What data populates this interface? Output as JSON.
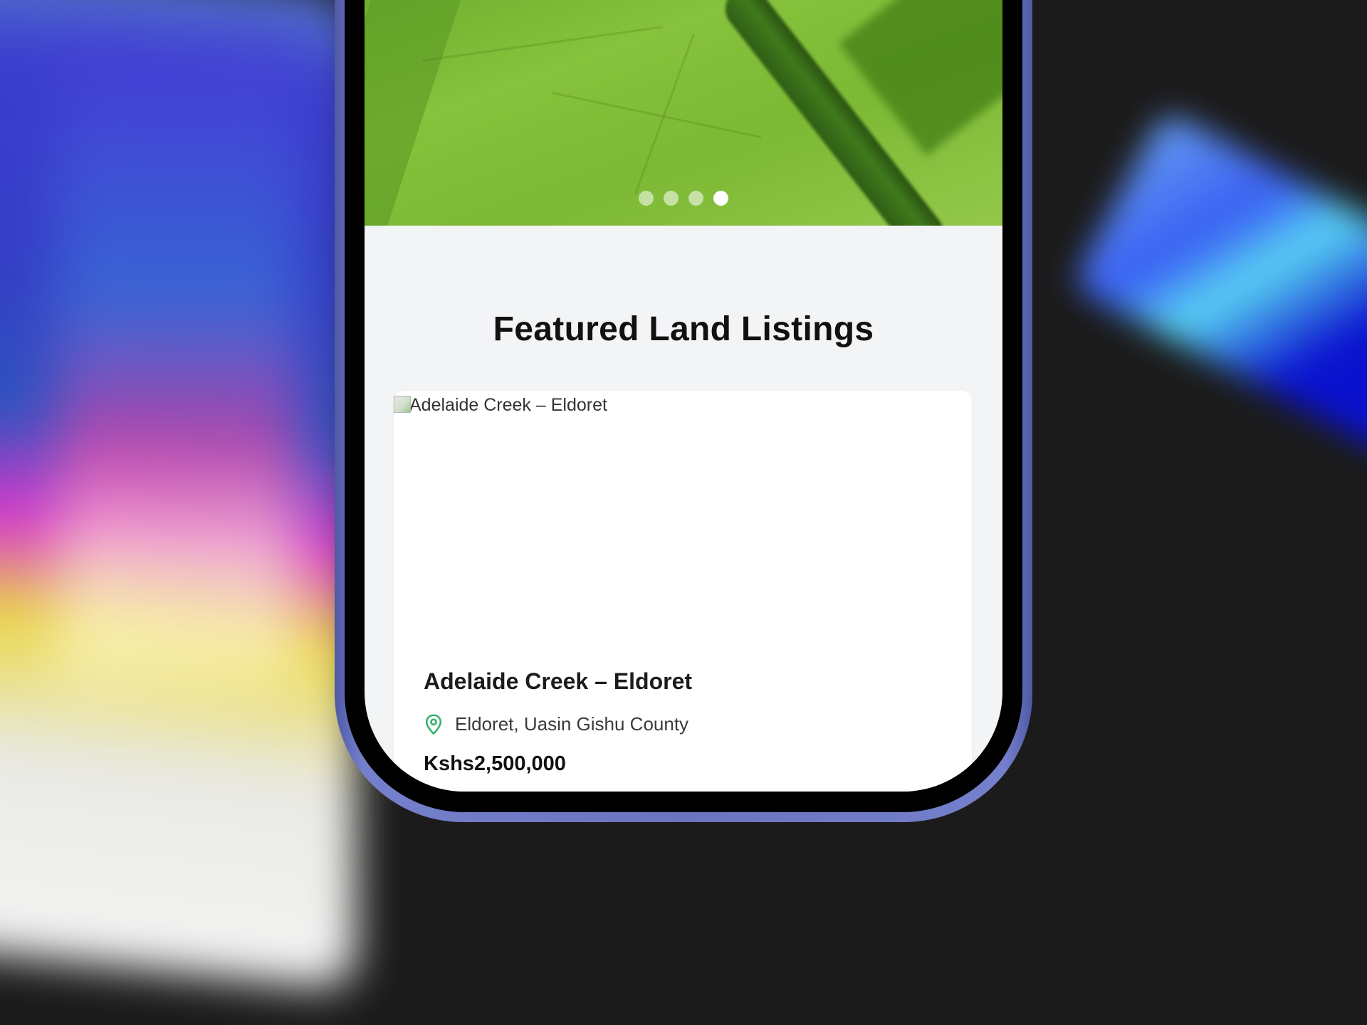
{
  "hero": {
    "slides_total": 4,
    "active_slide_index": 3
  },
  "section": {
    "title": "Featured Land Listings"
  },
  "listing": {
    "image_alt": "Adelaide Creek – Eldoret",
    "title": "Adelaide Creek – Eldoret",
    "location": "Eldoret, Uasin Gishu County",
    "price": "Kshs2,500,000"
  },
  "icons": {
    "location": "map-pin-icon",
    "broken_image": "broken-image-icon"
  },
  "colors": {
    "pin": "#2fb36a",
    "phone_frame": "#6a74bf",
    "page_bg": "#f3f4f6",
    "card_bg": "#ffffff"
  }
}
